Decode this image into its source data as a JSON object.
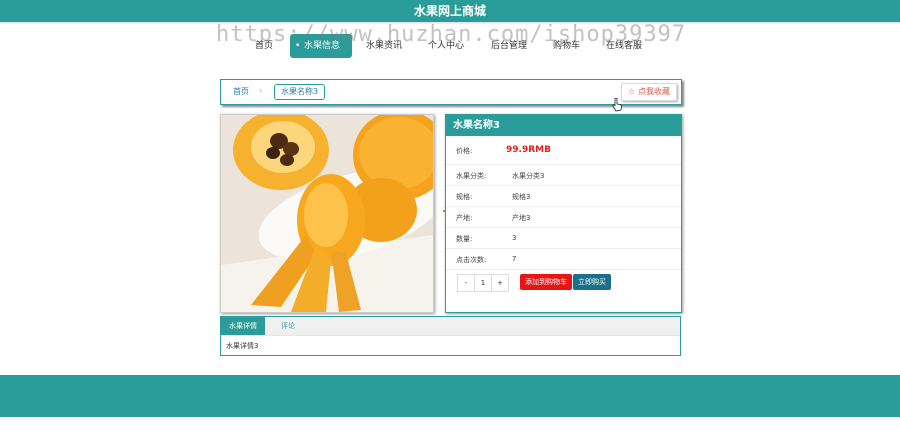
{
  "header": {
    "title": "水果网上商城"
  },
  "watermark": "https://www.huzhan.com/ishop39397",
  "nav": {
    "items": [
      "首页",
      "水果信息",
      "水果资讯",
      "个人中心",
      "后台管理",
      "购物车",
      "在线客服"
    ]
  },
  "breadcrumb": {
    "home": "首页",
    "separator": "›",
    "current": "水果名称3",
    "favorite": "☆ 点我收藏"
  },
  "product": {
    "name": "水果名称3",
    "price_label": "价格:",
    "price": "99.9RMB",
    "fields": [
      {
        "label": "水果分类:",
        "value": "水果分类3"
      },
      {
        "label": "规格:",
        "value": "规格3"
      },
      {
        "label": "产地:",
        "value": "产地3"
      },
      {
        "label": "数量:",
        "value": "3"
      },
      {
        "label": "点击次数:",
        "value": "7"
      }
    ],
    "qty": {
      "minus": "-",
      "value": "1",
      "plus": "+"
    },
    "add_cart": "添加到购物车",
    "buy_now": "立即购买"
  },
  "tabs": {
    "detail": "水果详情",
    "comments": "评论",
    "detail_text": "水果详情3"
  },
  "colors": {
    "accent": "#2a9d9a",
    "price": "#e02020",
    "cart_button": "#e81515",
    "buy_button": "#1d6f8a"
  }
}
